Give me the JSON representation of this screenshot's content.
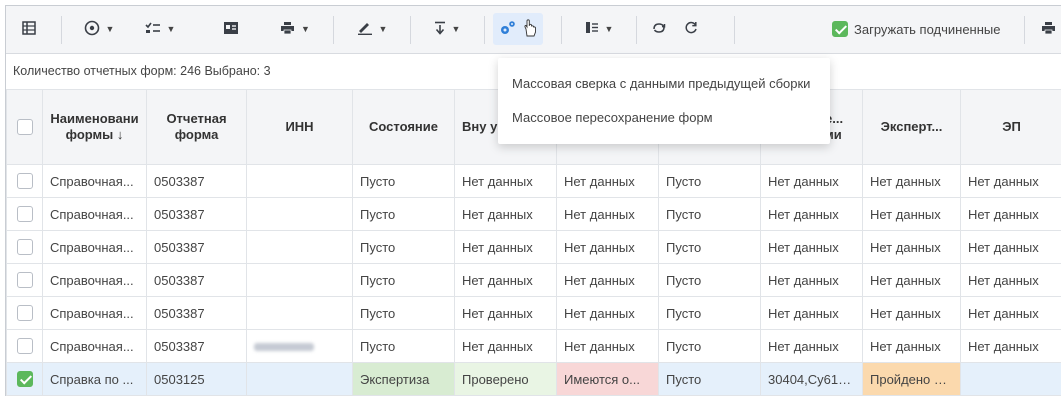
{
  "toolbar": {
    "load_subordinate_label": "Загружать подчиненные",
    "load_subordinate_checked": true,
    "icons": [
      "grid-icon",
      "circle-target-icon",
      "checklist-icon",
      "id-card-icon",
      "printer-icon",
      "pen-icon",
      "align-download-icon",
      "gears-icon",
      "filter-list-icon",
      "sync-icon",
      "refresh-icon",
      "printer-icon"
    ]
  },
  "info": {
    "text": "Количество отчетных форм: 246   Выбрано: 3"
  },
  "dropdown": {
    "items": [
      "Массовая сверка с данными предыдущей сборки",
      "Массовое пересохранение форм"
    ]
  },
  "table": {
    "headers": {
      "name": "Наименовани формы ↓",
      "form": "Отчетная форма",
      "inn": "ИНН",
      "state": "Состояние",
      "internal": "Вну ув",
      "col6": "",
      "col7": "",
      "svodki": "дки с ре... увязками",
      "expert": "Эксперт...",
      "ep": "ЭП"
    },
    "rows": [
      {
        "checked": false,
        "name": "Справочная...",
        "form": "0503387",
        "inn": "",
        "state": "Пусто",
        "internal": "Нет данных",
        "col6": "Нет данных",
        "col7": "Пусто",
        "svodki": "Нет данных",
        "expert": "Нет данных",
        "ep": "Нет данных"
      },
      {
        "checked": false,
        "name": "Справочная...",
        "form": "0503387",
        "inn": "",
        "state": "Пусто",
        "internal": "Нет данных",
        "col6": "Нет данных",
        "col7": "Пусто",
        "svodki": "Нет данных",
        "expert": "Нет данных",
        "ep": "Нет данных"
      },
      {
        "checked": false,
        "name": "Справочная...",
        "form": "0503387",
        "inn": "",
        "state": "Пусто",
        "internal": "Нет данных",
        "col6": "Нет данных",
        "col7": "Пусто",
        "svodki": "Нет данных",
        "expert": "Нет данных",
        "ep": "Нет данных"
      },
      {
        "checked": false,
        "name": "Справочная...",
        "form": "0503387",
        "inn": "",
        "state": "Пусто",
        "internal": "Нет данных",
        "col6": "Нет данных",
        "col7": "Пусто",
        "svodki": "Нет данных",
        "expert": "Нет данных",
        "ep": "Нет данных"
      },
      {
        "checked": false,
        "name": "Справочная...",
        "form": "0503387",
        "inn": "",
        "state": "Пусто",
        "internal": "Нет данных",
        "col6": "Нет данных",
        "col7": "Пусто",
        "svodki": "Нет данных",
        "expert": "Нет данных",
        "ep": "Нет данных"
      },
      {
        "checked": false,
        "name": "Справочная...",
        "form": "0503387",
        "inn": "blurred",
        "state": "Пусто",
        "internal": "Нет данных",
        "col6": "Нет данных",
        "col7": "Пусто",
        "svodki": "Нет данных",
        "expert": "Нет данных",
        "ep": "Нет данных"
      },
      {
        "checked": true,
        "name": "Справка по ...",
        "form": "0503125",
        "inn": "",
        "state": "Экспертиза",
        "internal": "Проверено",
        "col6": "Имеются о...",
        "col7": "Пусто",
        "svodki": "30404,Су613...",
        "expert": "Пройдено 0 ...",
        "ep": ""
      }
    ]
  },
  "colors": {
    "accent_check": "#5cb85c",
    "selected_row": "#e5f0fb",
    "status_green": "#d8ecd2",
    "status_pink": "#f8d7d7",
    "status_orange": "#fbd9ad"
  }
}
